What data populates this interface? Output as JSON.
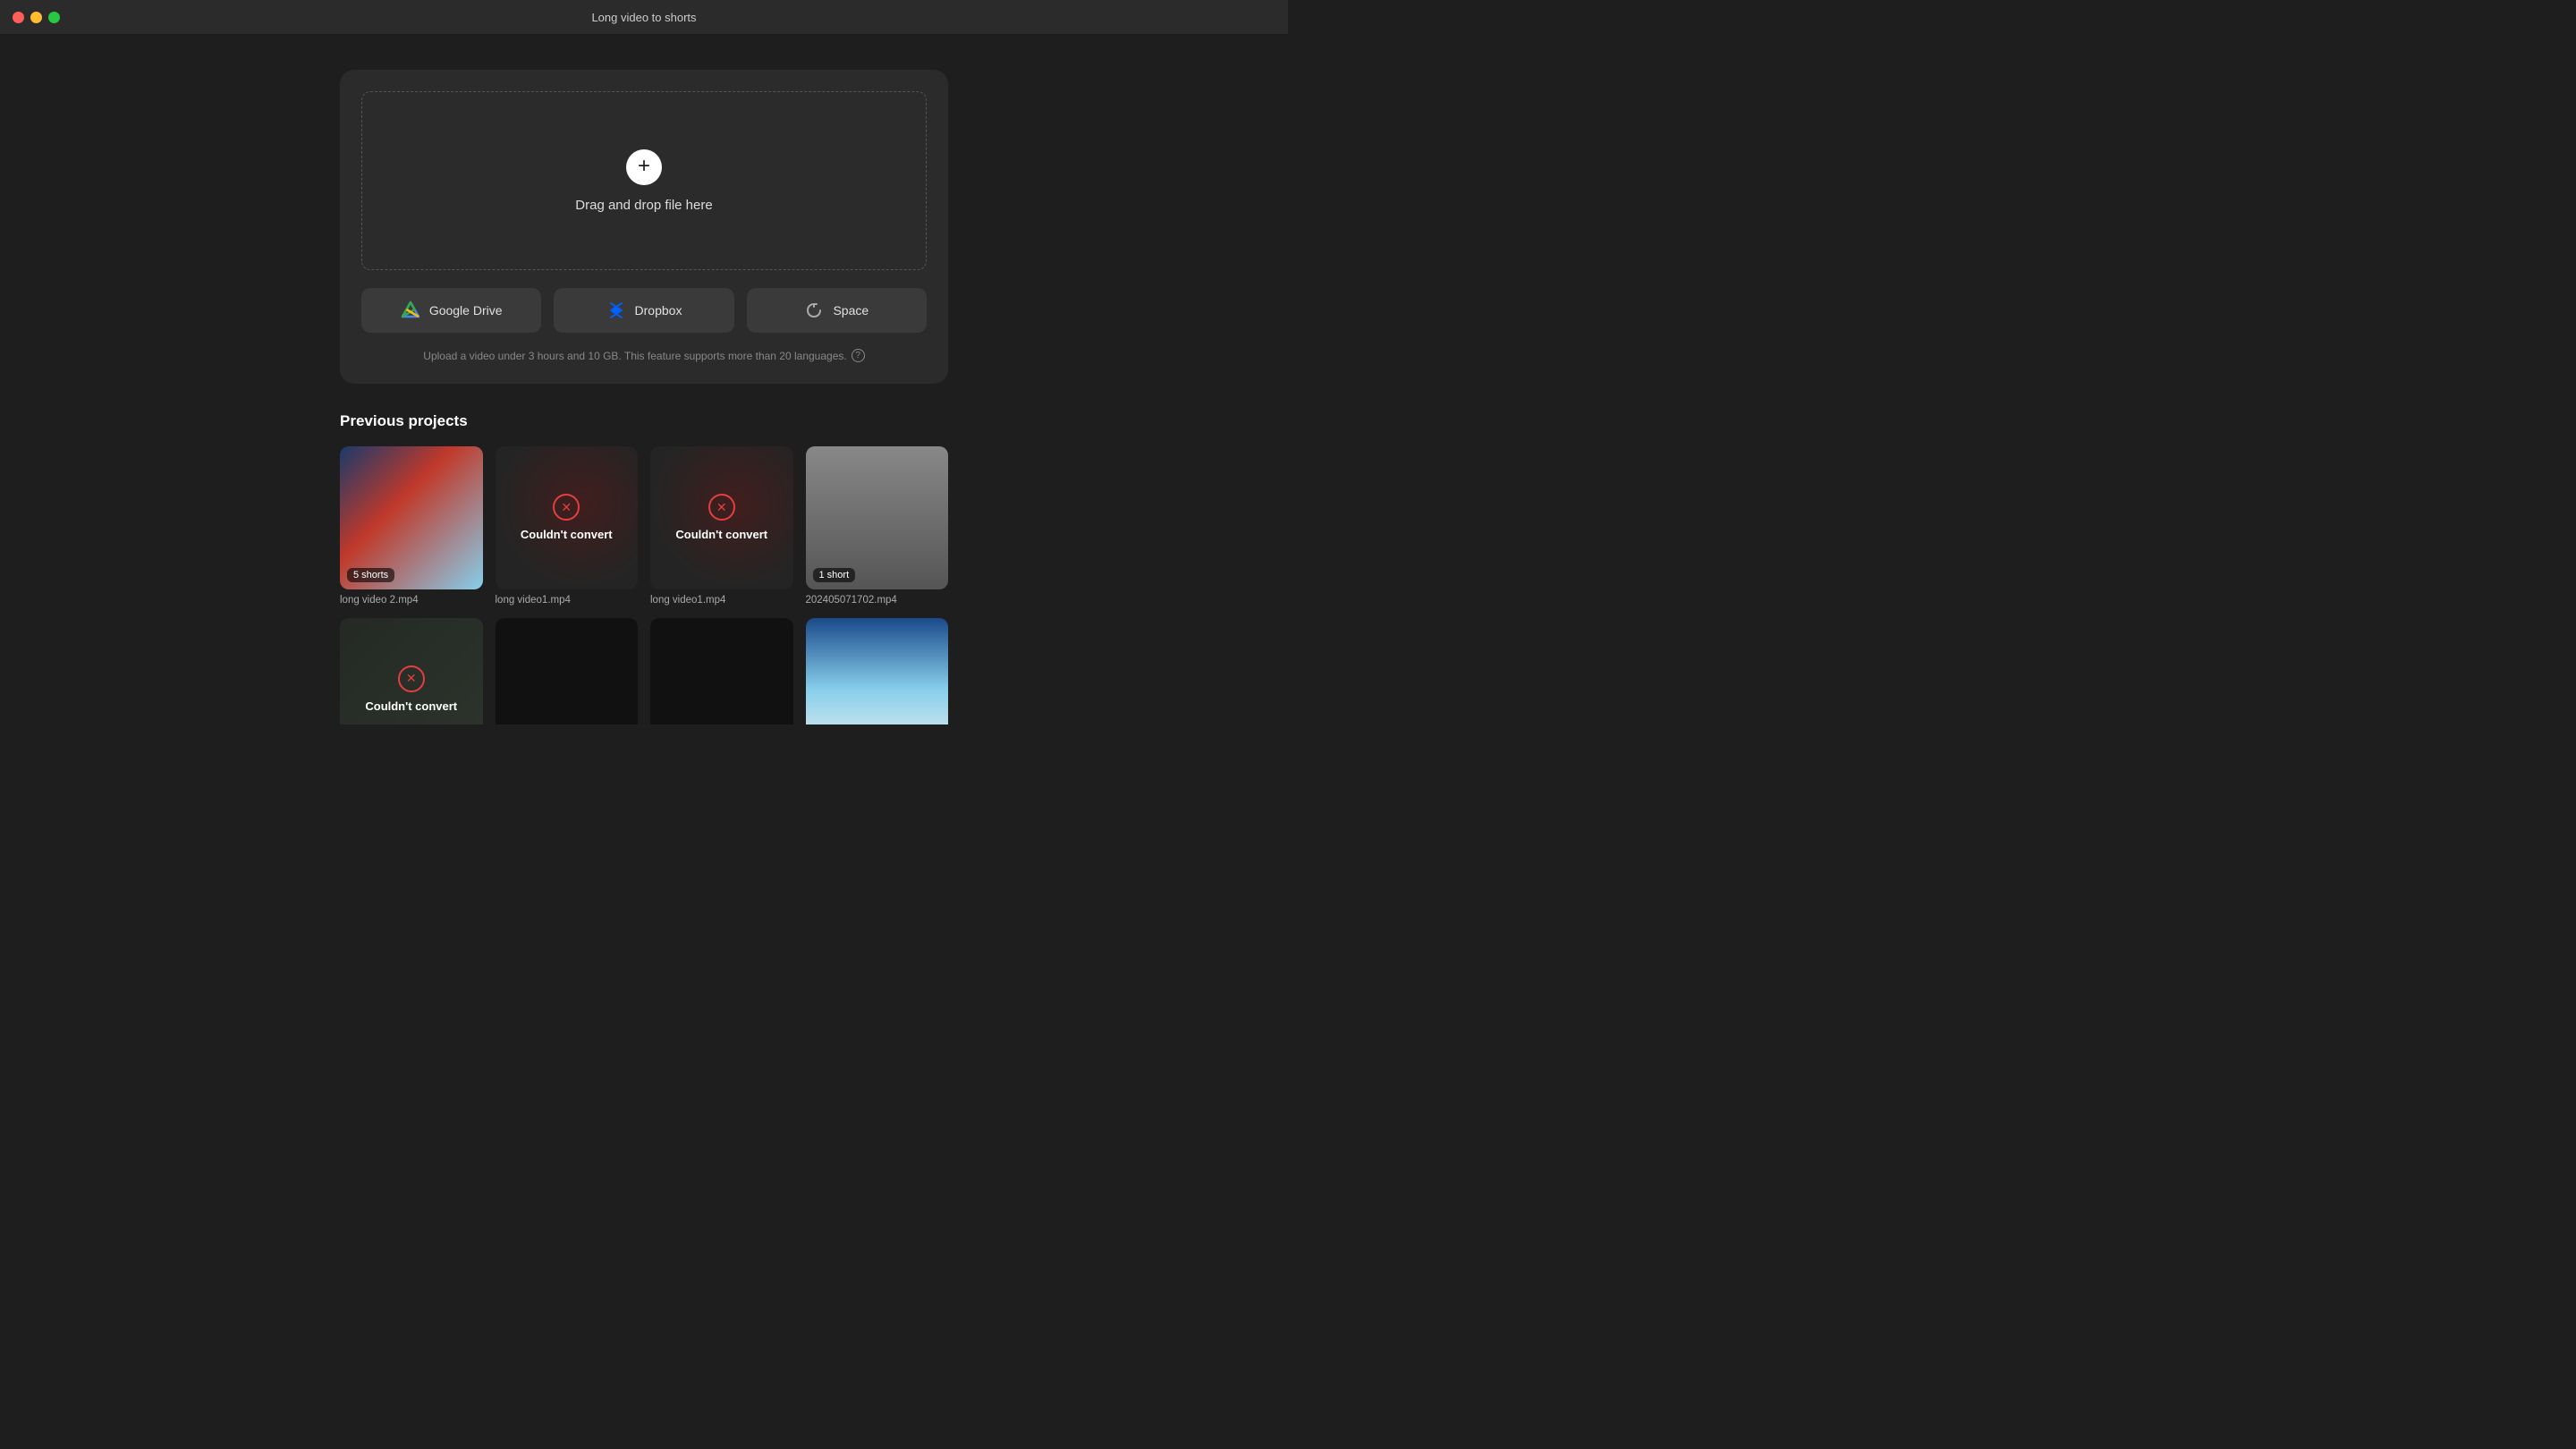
{
  "titlebar": {
    "title": "Long video to shorts"
  },
  "upload": {
    "drop_text": "Drag and drop file here",
    "source_buttons": [
      {
        "id": "google-drive",
        "label": "Google Drive"
      },
      {
        "id": "dropbox",
        "label": "Dropbox"
      },
      {
        "id": "space",
        "label": "Space"
      }
    ],
    "info_text": "Upload a video under 3 hours and 10 GB. This feature supports more than 20 languages.",
    "info_icon": "?"
  },
  "previous": {
    "section_title": "Previous projects",
    "projects": [
      {
        "id": "proj-1",
        "name": "long video 2.mp4",
        "thumb_type": "mountain",
        "status": "success",
        "badge": "5 shorts"
      },
      {
        "id": "proj-2",
        "name": "long video1.mp4",
        "thumb_type": "dark-red",
        "status": "error",
        "error_text": "Couldn't convert"
      },
      {
        "id": "proj-3",
        "name": "long video1.mp4",
        "thumb_type": "dark-red",
        "status": "error",
        "error_text": "Couldn't convert"
      },
      {
        "id": "proj-4",
        "name": "202405071702.mp4",
        "thumb_type": "person",
        "status": "success",
        "badge": "1 short"
      },
      {
        "id": "proj-5",
        "name": "",
        "thumb_type": "plant",
        "status": "error",
        "error_text": "Couldn't convert"
      },
      {
        "id": "proj-6",
        "name": "",
        "thumb_type": "dark",
        "status": "success",
        "badge": ""
      },
      {
        "id": "proj-7",
        "name": "",
        "thumb_type": "dark",
        "status": "success",
        "badge": ""
      },
      {
        "id": "proj-8",
        "name": "",
        "thumb_type": "sky",
        "status": "success",
        "badge": ""
      }
    ]
  }
}
